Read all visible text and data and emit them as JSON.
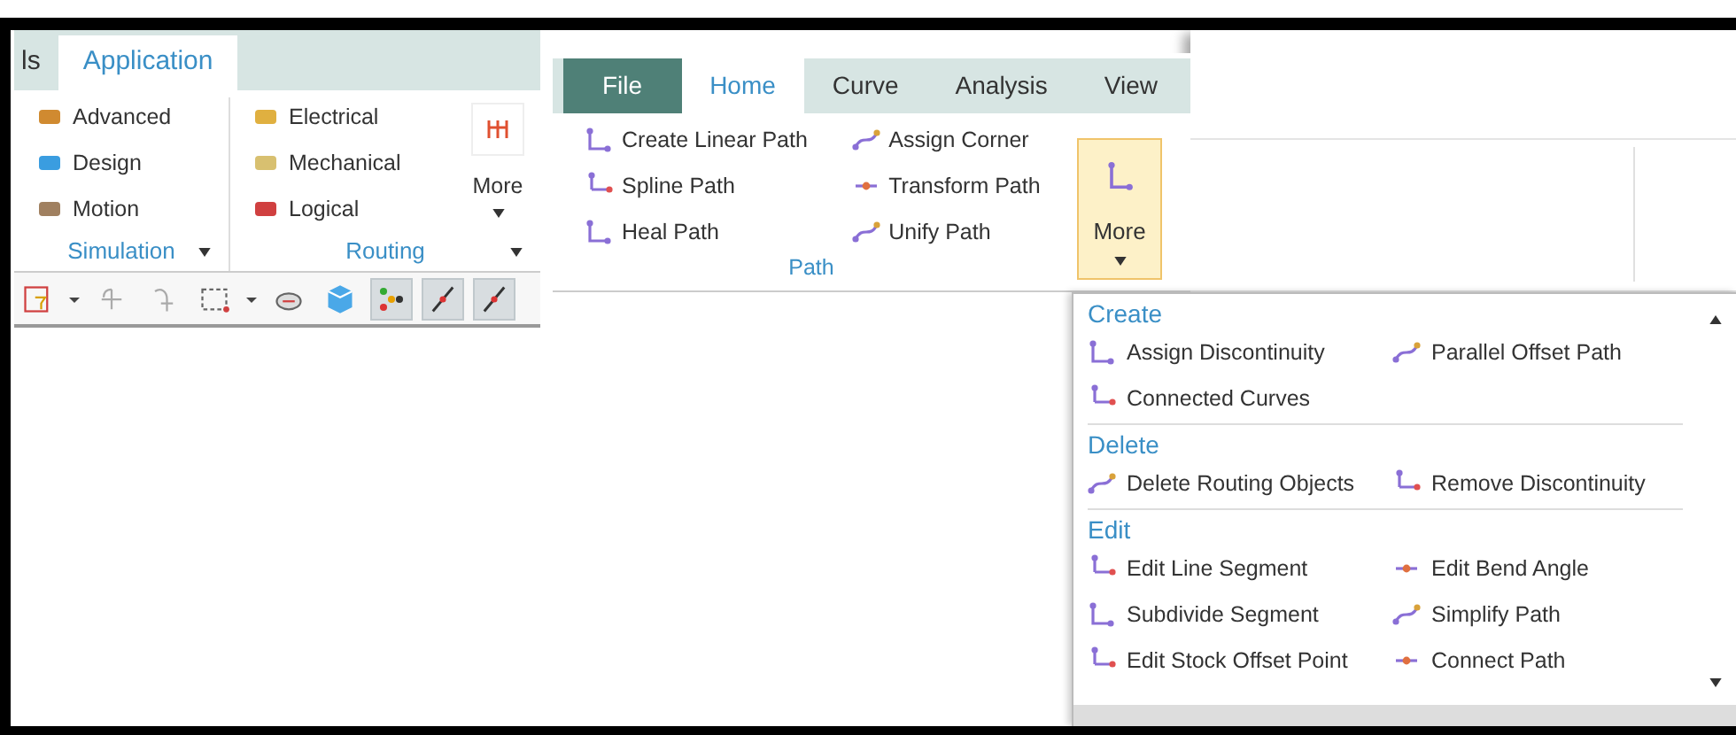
{
  "left_ribbon": {
    "tabs": [
      {
        "label": "ls",
        "selected": false
      },
      {
        "label": "Application",
        "selected": true
      }
    ],
    "groups": [
      {
        "label": "Simulation",
        "items": [
          "Advanced",
          "Design",
          "Motion"
        ]
      },
      {
        "label": "Routing",
        "items": [
          "Electrical",
          "Mechanical",
          "Logical"
        ],
        "more": "More"
      }
    ],
    "toolbar": [
      {
        "kind": "filter",
        "selected": false
      },
      {
        "kind": "caret",
        "selected": false
      },
      {
        "kind": "move",
        "selected": false
      },
      {
        "kind": "copy",
        "selected": false
      },
      {
        "kind": "select",
        "selected": false
      },
      {
        "kind": "caret",
        "selected": false
      },
      {
        "kind": "view",
        "selected": false
      },
      {
        "kind": "cube",
        "selected": false
      },
      {
        "kind": "nodes",
        "selected": true
      },
      {
        "kind": "line",
        "selected": true
      },
      {
        "kind": "line",
        "selected": true
      }
    ]
  },
  "right_ribbon": {
    "tabs": [
      {
        "label": "File",
        "kind": "file",
        "selected": false
      },
      {
        "label": "Home",
        "kind": "tab",
        "selected": true
      },
      {
        "label": "Curve",
        "kind": "tab",
        "selected": false
      },
      {
        "label": "Analysis",
        "kind": "tab",
        "selected": false
      },
      {
        "label": "View",
        "kind": "tab",
        "selected": false
      }
    ],
    "group": {
      "label": "Path",
      "items": [
        "Create Linear Path",
        "Assign Corner",
        "Spline Path",
        "Transform Path",
        "Heal Path",
        "Unify Path"
      ]
    },
    "more": {
      "label": "More",
      "expanded": true
    }
  },
  "more_menu": {
    "sections": [
      {
        "title": "Create",
        "items": [
          "Assign Discontinuity",
          "Parallel Offset Path",
          "Connected Curves"
        ]
      },
      {
        "title": "Delete",
        "items": [
          "Delete Routing Objects",
          "Remove Discontinuity"
        ]
      },
      {
        "title": "Edit",
        "items": [
          "Edit Line Segment",
          "Edit Bend Angle",
          "Subdivide Segment",
          "Simplify Path",
          "Edit Stock Offset Point",
          "Connect Path"
        ]
      }
    ]
  }
}
